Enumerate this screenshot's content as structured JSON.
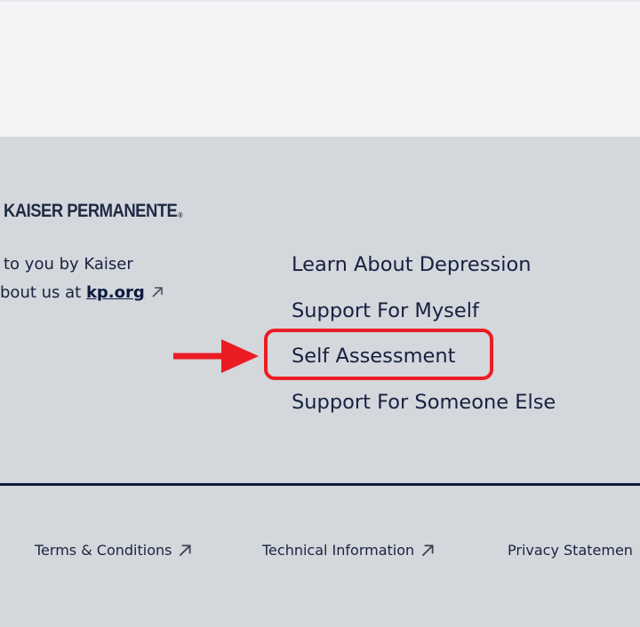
{
  "brand": {
    "name": "KAISER PERMANENTE",
    "registered": "®"
  },
  "about": {
    "line1": "to you by Kaiser",
    "line2_prefix": "bout us at ",
    "link_text": "kp.org"
  },
  "nav": {
    "items": [
      "Learn About Depression",
      "Support For Myself",
      "Self Assessment",
      "Support For Someone Else"
    ]
  },
  "legal": {
    "terms": "Terms & Conditions",
    "technical": "Technical Information",
    "privacy": "Privacy Statemen"
  },
  "colors": {
    "footer_background": "#d4d7dc",
    "top_background": "#f3f4f6",
    "text": "#16213f",
    "divider": "#0f1d3a",
    "annotation": "#ec1c24"
  },
  "icons": {
    "external_link": "external-link-icon",
    "annotation_arrow": "red-arrow-icon"
  }
}
